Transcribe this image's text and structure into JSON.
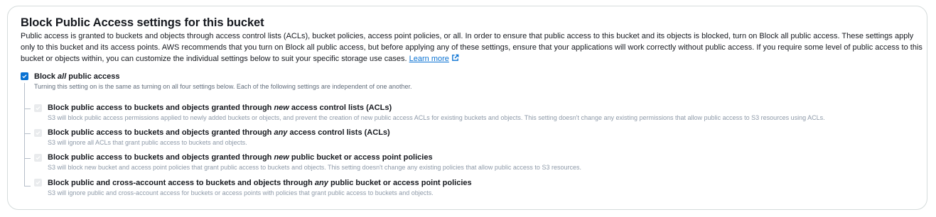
{
  "section": {
    "title": "Block Public Access settings for this bucket",
    "description": "Public access is granted to buckets and objects through access control lists (ACLs), bucket policies, access point policies, or all. In order to ensure that public access to this bucket and its objects is blocked, turn on Block all public access. These settings apply only to this bucket and its access points. AWS recommends that you turn on Block all public access, but before applying any of these settings, ensure that your applications will work correctly without public access. If you require some level of public access to this bucket or objects within, you can customize the individual settings below to suit your specific storage use cases.",
    "learn_more": "Learn more",
    "accent_color": "#0972d3"
  },
  "block_all": {
    "label_pre": "Block ",
    "label_em": "all",
    "label_post": " public access",
    "checked": true,
    "description": "Turning this setting on is the same as turning on all four settings below. Each of the following settings are independent of one another."
  },
  "settings": [
    {
      "label_pre": "Block public access to buckets and objects granted through ",
      "label_em": "new",
      "label_post": " access control lists (ACLs)",
      "description": "S3 will block public access permissions applied to newly added buckets or objects, and prevent the creation of new public access ACLs for existing buckets and objects. This setting doesn't change any existing permissions that allow public access to S3 resources using ACLs.",
      "checked": true,
      "disabled": true
    },
    {
      "label_pre": "Block public access to buckets and objects granted through ",
      "label_em": "any",
      "label_post": " access control lists (ACLs)",
      "description": "S3 will ignore all ACLs that grant public access to buckets and objects.",
      "checked": true,
      "disabled": true
    },
    {
      "label_pre": "Block public access to buckets and objects granted through ",
      "label_em": "new",
      "label_post": " public bucket or access point policies",
      "description": "S3 will block new bucket and access point policies that grant public access to buckets and objects. This setting doesn't change any existing policies that allow public access to S3 resources.",
      "checked": true,
      "disabled": true
    },
    {
      "label_pre": "Block public and cross-account access to buckets and objects through ",
      "label_em": "any",
      "label_post": " public bucket or access point policies",
      "description": "S3 will ignore public and cross-account access for buckets or access points with policies that grant public access to buckets and objects.",
      "checked": true,
      "disabled": true
    }
  ]
}
